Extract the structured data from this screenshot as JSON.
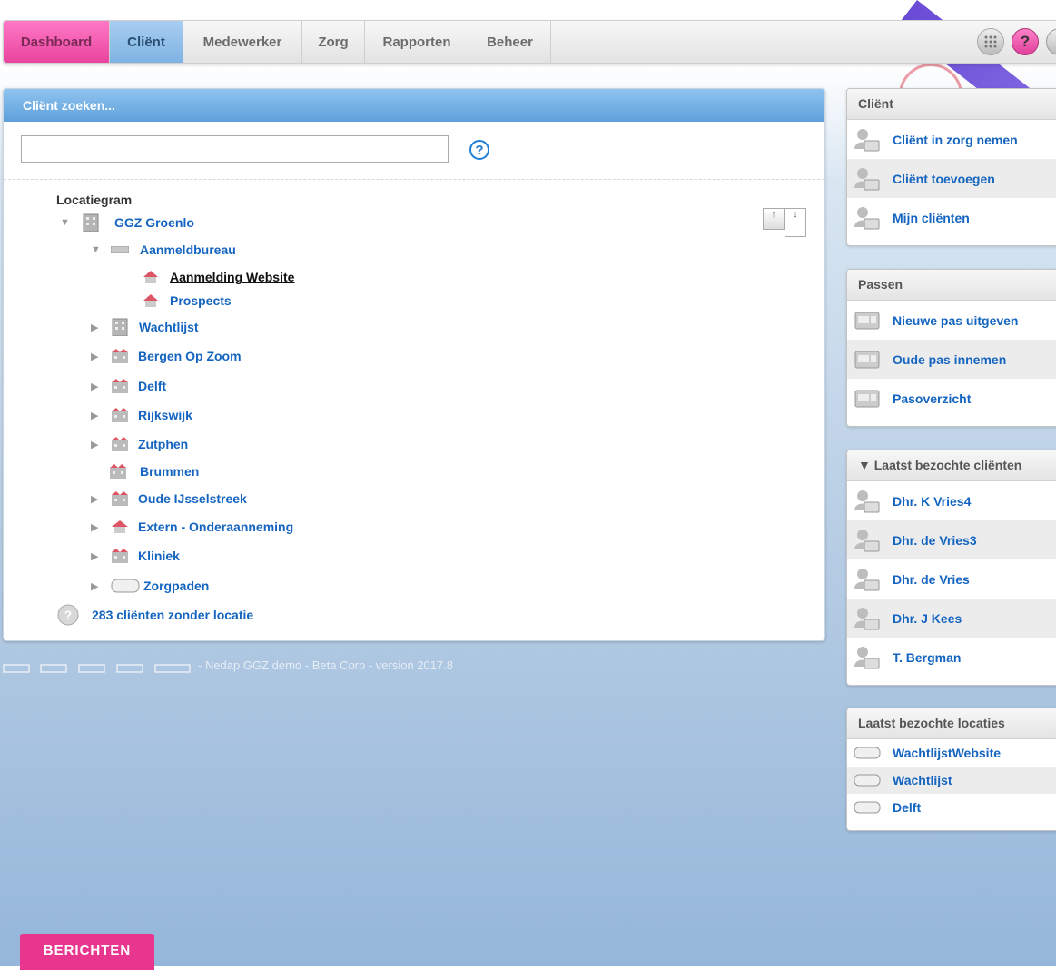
{
  "nav": {
    "tabs": [
      "Dashboard",
      "Cliënt",
      "Medewerker",
      "Zorg",
      "Rapporten",
      "Beheer"
    ],
    "apps_icon": "apps-grid-icon",
    "help_label": "?",
    "user_icon": "user-menu-icon"
  },
  "search": {
    "title": "Cliënt zoeken...",
    "value": "",
    "placeholder": "",
    "help_label": "?"
  },
  "tree": {
    "title": "Locatiegram",
    "items": [
      {
        "label": "GGZ Groenlo",
        "icon": "building-icon",
        "expanded": true
      },
      {
        "label": "Aanmeldbureau",
        "icon": "card-icon",
        "expanded": true
      },
      {
        "label": "Aanmelding Website",
        "icon": "house-icon"
      },
      {
        "label": "Prospects",
        "icon": "house-icon"
      },
      {
        "label": "Wachtlijst",
        "icon": "building-icon"
      },
      {
        "label": "Bergen Op Zoom",
        "icon": "houses-icon"
      },
      {
        "label": "Delft",
        "icon": "houses-icon"
      },
      {
        "label": "Rijkswijk",
        "icon": "houses-icon"
      },
      {
        "label": "Zutphen",
        "icon": "houses-icon"
      },
      {
        "label": "Brummen",
        "icon": "houses-icon"
      },
      {
        "label": "Oude IJsselstreek",
        "icon": "houses-icon"
      },
      {
        "label": "Extern - Onderaanneming",
        "icon": "house-icon"
      },
      {
        "label": "Kliniek",
        "icon": "houses-icon"
      },
      {
        "label": "Zorgpaden",
        "icon": "pill-icon"
      }
    ],
    "without_location": "283 cliënten zonder locatie"
  },
  "footer": {
    "text": "- Nedap GGZ demo - Beta Corp - version 2017.8"
  },
  "side": {
    "client": {
      "title": "Cliënt",
      "items": [
        "Cliënt in zorg nemen",
        "Cliënt toevoegen",
        "Mijn cliënten"
      ]
    },
    "passen": {
      "title": "Passen",
      "items": [
        "Nieuwe pas uitgeven",
        "Oude pas innemen",
        "Pasoverzicht"
      ]
    },
    "recent_clients": {
      "title": "▼ Laatst bezochte cliënten",
      "items": [
        "Dhr. K Vries4",
        "Dhr. de Vries3",
        "Dhr. de Vries",
        "Dhr. J Kees",
        "T. Bergman"
      ]
    },
    "recent_locations": {
      "title": "Laatst bezochte locaties",
      "items": [
        "WachtlijstWebsite",
        "Wachtlijst",
        "Delft"
      ]
    }
  },
  "berichten": "BERICHTEN",
  "colors": {
    "link": "#1565c0",
    "dashboard_tab": "#e9449f",
    "client_tab": "#7eb3e3",
    "panel_header": "#5ea1db",
    "berichten": "#e8368f"
  }
}
